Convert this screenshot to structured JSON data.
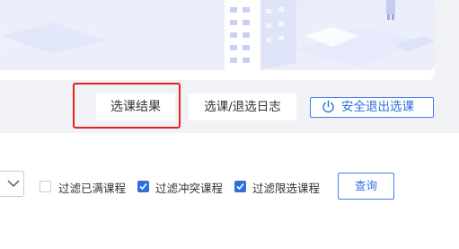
{
  "colors": {
    "accent": "#2f6fdc",
    "highlight_border": "#e5231b",
    "page_bg": "#f1f2f6"
  },
  "actions": {
    "result_label": "选课结果",
    "log_label": "选课/退选日志",
    "exit_label": "安全退出选课",
    "exit_icon": "power-icon"
  },
  "filters": {
    "items": [
      {
        "label": "过滤已满课程",
        "checked": false
      },
      {
        "label": "过滤冲突课程",
        "checked": true
      },
      {
        "label": "过滤限选课程",
        "checked": true
      }
    ],
    "select_icon": "chevron-down-icon",
    "query_label": "查询"
  }
}
